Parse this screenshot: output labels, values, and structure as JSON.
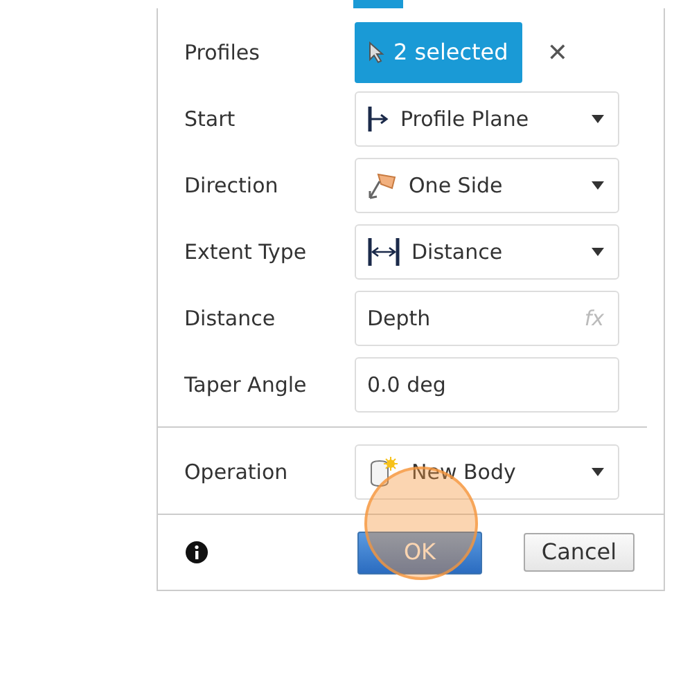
{
  "sections": [
    {
      "rows": [
        {
          "kind": "selection",
          "label": "Profiles",
          "value": "2 selected",
          "clear": "✕"
        },
        {
          "kind": "dropdown",
          "label": "Start",
          "value": "Profile Plane"
        },
        {
          "kind": "dropdown",
          "label": "Direction",
          "value": "One Side"
        },
        {
          "kind": "dropdown",
          "label": "Extent Type",
          "value": "Distance"
        },
        {
          "kind": "input",
          "label": "Distance",
          "value": "Depth",
          "suffix": "fx"
        },
        {
          "kind": "input",
          "label": "Taper Angle",
          "value": "0.0 deg"
        }
      ]
    },
    {
      "rows": [
        {
          "kind": "dropdown",
          "label": "Operation",
          "value": "New Body"
        }
      ]
    }
  ],
  "footer": {
    "ok": "OK",
    "cancel": "Cancel"
  }
}
